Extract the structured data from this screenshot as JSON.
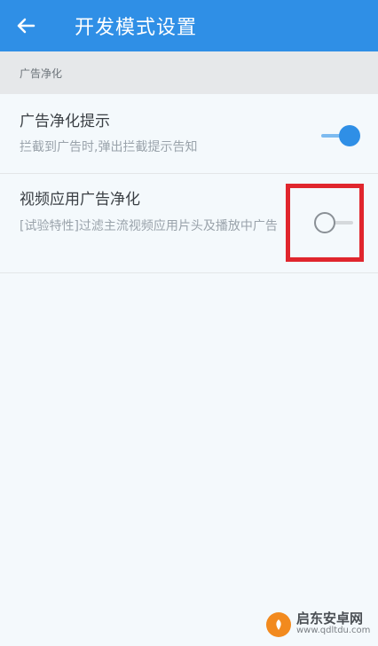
{
  "appbar": {
    "title": "开发模式设置",
    "back_icon": "arrow-left-icon",
    "color": "#2f8fe6"
  },
  "section": {
    "header": "广告净化"
  },
  "settings": [
    {
      "title": "广告净化提示",
      "description": "拦截到广告时,弹出拦截提示告知",
      "enabled": true
    },
    {
      "title": "视频应用广告净化",
      "description": "[试验特性]过滤主流视频应用片头及播放中广告",
      "enabled": false
    }
  ],
  "highlight": {
    "color": "#e0262d"
  },
  "watermark": {
    "name": "启东安卓网",
    "url": "www.qdltdu.com"
  }
}
